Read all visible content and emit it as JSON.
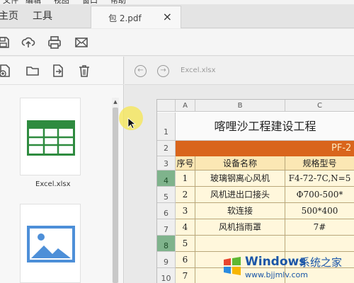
{
  "menu": {
    "items": [
      "文件",
      "编辑",
      "视图",
      "窗口",
      "帮助"
    ]
  },
  "tabs": {
    "home": "主页",
    "tools": "工具",
    "document": "包 2.pdf",
    "close": "×"
  },
  "toolbar": {
    "icons": [
      "save-icon",
      "upload-icon",
      "print-icon",
      "mail-icon"
    ]
  },
  "left_panel": {
    "toolbar_icons": [
      "add-file-icon",
      "folder-icon",
      "export-icon",
      "trash-icon"
    ],
    "attachments": [
      {
        "name": "Excel.xlsx",
        "type": "spreadsheet"
      },
      {
        "name": "",
        "type": "image"
      }
    ]
  },
  "viewer": {
    "back": "←",
    "forward": "→",
    "title": "Excel.xlsx"
  },
  "sheet": {
    "columns": [
      "A",
      "B",
      "C"
    ],
    "title": "喀哩沙工程建设工程",
    "code": "PF-2",
    "headers": [
      "序号",
      "设备名称",
      "规格型号"
    ],
    "rows": [
      {
        "row": "4",
        "no": "1",
        "name": "玻璃钢离心风机",
        "spec": "F4-72-7C,N=5"
      },
      {
        "row": "5",
        "no": "2",
        "name": "风机进出口接头",
        "spec": "Φ700-500*"
      },
      {
        "row": "6",
        "no": "3",
        "name": "软连接",
        "spec": "500*400"
      },
      {
        "row": "7",
        "no": "4",
        "name": "风机挡雨罩",
        "spec": "7#"
      },
      {
        "row": "8",
        "no": "5",
        "name": "",
        "spec": ""
      },
      {
        "row": "9",
        "no": "6",
        "name": "",
        "spec": ""
      },
      {
        "row": "10",
        "no": "7",
        "name": "",
        "spec": ""
      }
    ],
    "row_labels": {
      "r1": "1",
      "r2": "2",
      "r3": "3"
    }
  },
  "watermark": {
    "brand": "Windows",
    "suffix": "系统之家",
    "url": "www.bjjmlv.com"
  },
  "colors": {
    "accent_orange": "#d9651c",
    "header_fill": "#fbe7b4",
    "selected_row": "#7fb38c",
    "brand_blue": "#1a56a8"
  }
}
